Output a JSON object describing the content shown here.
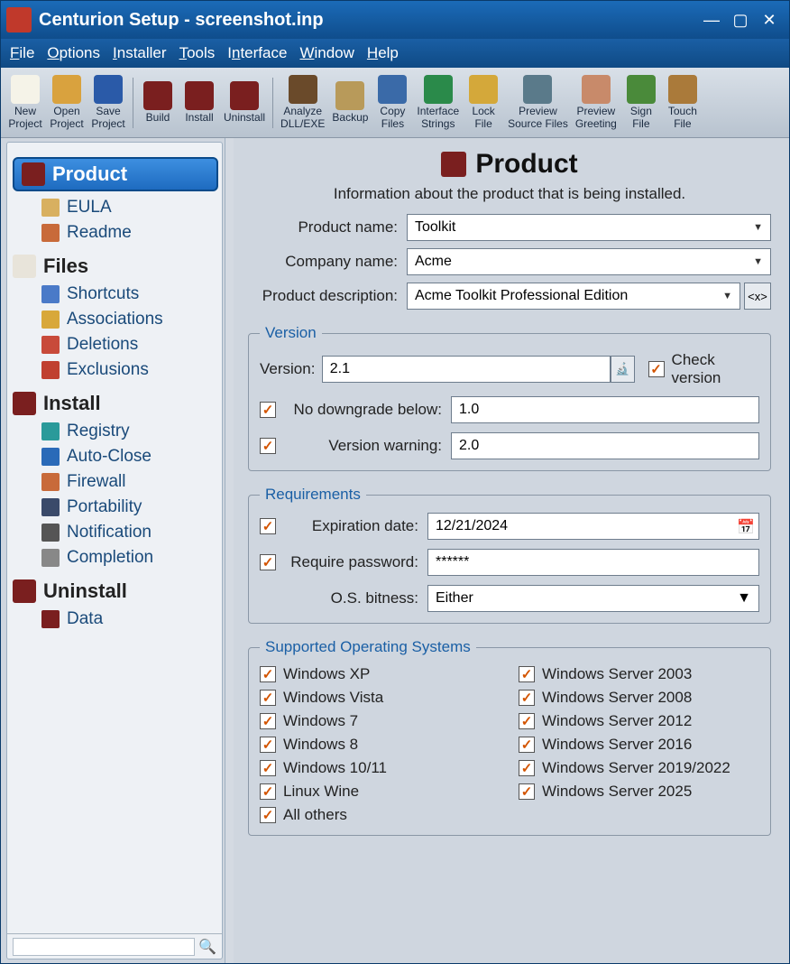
{
  "window": {
    "title": "Centurion Setup - screenshot.inp"
  },
  "menu": {
    "file": "File",
    "options": "Options",
    "installer": "Installer",
    "tools": "Tools",
    "interface": "Interface",
    "window": "Window",
    "help": "Help"
  },
  "toolbar": {
    "new_project": "New\nProject",
    "open_project": "Open\nProject",
    "save_project": "Save\nProject",
    "build": "Build",
    "install": "Install",
    "uninstall": "Uninstall",
    "analyze": "Analyze\nDLL/EXE",
    "backup": "Backup",
    "copy_files": "Copy\nFiles",
    "interface_strings": "Interface\nStrings",
    "lock_file": "Lock\nFile",
    "preview_source": "Preview\nSource Files",
    "preview_greeting": "Preview\nGreeting",
    "sign_file": "Sign\nFile",
    "touch_file": "Touch\nFile"
  },
  "sidebar": {
    "product": "Product",
    "eula": "EULA",
    "readme": "Readme",
    "files": "Files",
    "shortcuts": "Shortcuts",
    "associations": "Associations",
    "deletions": "Deletions",
    "exclusions": "Exclusions",
    "install": "Install",
    "registry": "Registry",
    "autoclose": "Auto-Close",
    "firewall": "Firewall",
    "portability": "Portability",
    "notification": "Notification",
    "completion": "Completion",
    "uninstall": "Uninstall",
    "data": "Data"
  },
  "page": {
    "title": "Product",
    "subtitle": "Information about the product that is being installed.",
    "labels": {
      "product_name": "Product name:",
      "company_name": "Company name:",
      "product_description": "Product description:"
    },
    "values": {
      "product_name": "Toolkit",
      "company_name": "Acme",
      "product_description": "Acme Toolkit Professional Edition"
    }
  },
  "version": {
    "legend": "Version",
    "version_label": "Version:",
    "version_value": "2.1",
    "check_version": "Check version",
    "no_downgrade_label": "No downgrade below:",
    "no_downgrade_value": "1.0",
    "warning_label": "Version warning:",
    "warning_value": "2.0"
  },
  "requirements": {
    "legend": "Requirements",
    "expiration_label": "Expiration date:",
    "expiration_value": "12/21/2024",
    "password_label": "Require password:",
    "password_value": "******",
    "bitness_label": "O.S. bitness:",
    "bitness_value": "Either"
  },
  "os": {
    "legend": "Supported Operating Systems",
    "xp": "Windows XP",
    "s2003": "Windows Server 2003",
    "vista": "Windows Vista",
    "s2008": "Windows Server 2008",
    "w7": "Windows 7",
    "s2012": "Windows Server 2012",
    "w8": "Windows 8",
    "s2016": "Windows Server 2016",
    "w10": "Windows 10/11",
    "s2019": "Windows Server 2019/2022",
    "wine": "Linux Wine",
    "s2025": "Windows Server 2025",
    "others": "All others"
  }
}
